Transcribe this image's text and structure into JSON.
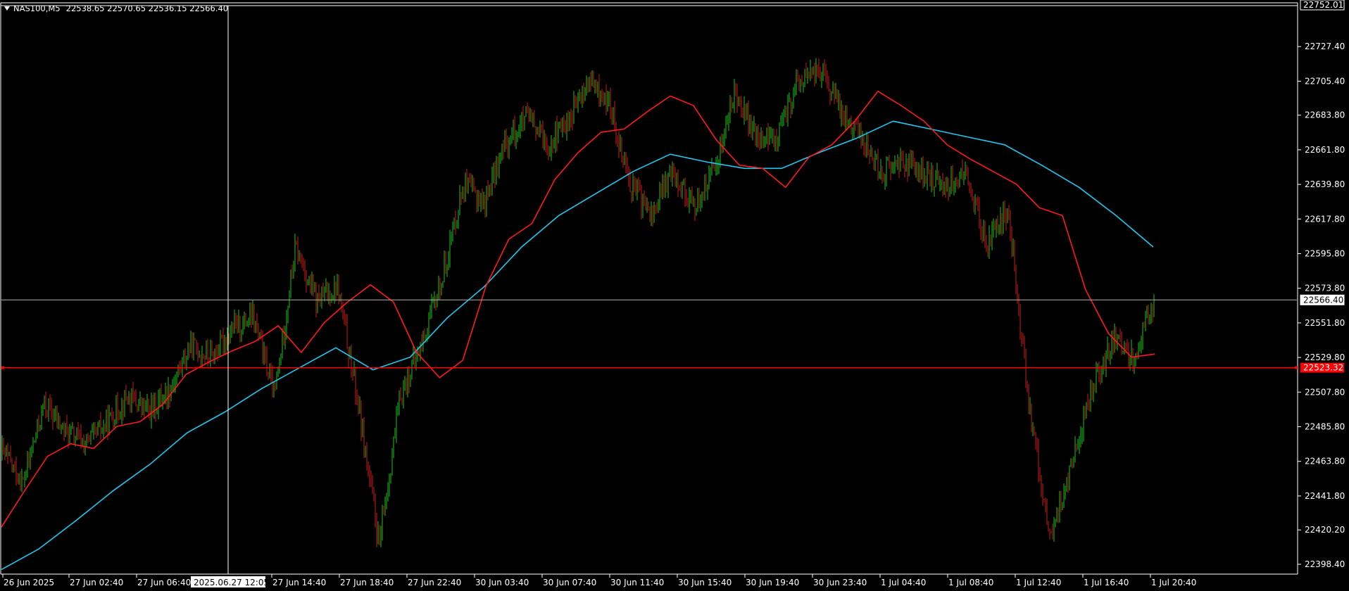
{
  "window": {
    "symbol": "NAS100,M5",
    "ohlc": "22538.65 22570.65 22536.15 22566.40"
  },
  "colors": {
    "background": "#000000",
    "bull_candle": "#22c01e",
    "bear_candle": "#c81e1e",
    "ma_fast": "#ff1a1a",
    "ma_slow": "#1ec8f0",
    "price_line": "#ff0000",
    "bid_line": "#b4b4b4",
    "grid": "#ffffff"
  },
  "price_axis": {
    "top_label": "22752.01",
    "ticks": [
      "22727.40",
      "22705.40",
      "22683.80",
      "22661.80",
      "22639.80",
      "22617.80",
      "22595.80",
      "22573.80",
      "22551.80",
      "22529.80",
      "22507.80",
      "22485.80",
      "22463.80",
      "22441.80",
      "22420.20",
      "22398.40"
    ],
    "current_price": "22566.40",
    "marked_price": "22523.32"
  },
  "time_axis": {
    "labels": [
      "26 Jun 2025",
      "27 Jun 02:40",
      "27 Jun 06:40",
      "27 Jun 14:40",
      "27 Jun 18:40",
      "27 Jun 22:40",
      "30 Jun 03:40",
      "30 Jun 07:40",
      "30 Jun 11:40",
      "30 Jun 15:40",
      "30 Jun 19:40",
      "30 Jun 23:40",
      "1 Jul 04:40",
      "1 Jul 08:40",
      "1 Jul 12:40",
      "1 Jul 16:40",
      "1 Jul 20:40"
    ],
    "crosshair_label": "2025.06.27 12:05"
  },
  "chart_data": {
    "type": "candlestick",
    "symbol": "NAS100",
    "timeframe": "M5",
    "ylim": [
      22390,
      22752.01
    ],
    "close_path": [
      {
        "t": "26 Jun 2025",
        "price": 22470
      },
      {
        "t": "26 Jun",
        "price": 22450
      },
      {
        "t": "26 Jun",
        "price": 22500
      },
      {
        "t": "26 Jun",
        "price": 22483
      },
      {
        "t": "27 Jun 02:40",
        "price": 22475
      },
      {
        "t": "27 Jun 02:40",
        "price": 22488
      },
      {
        "t": "27 Jun 02:40",
        "price": 22505
      },
      {
        "t": "27 Jun 06:40",
        "price": 22495
      },
      {
        "t": "27 Jun 06:40",
        "price": 22510
      },
      {
        "t": "27 Jun 06:40",
        "price": 22537
      },
      {
        "t": "27 Jun 12:05",
        "price": 22530
      },
      {
        "t": "27 Jun 14:40",
        "price": 22548
      },
      {
        "t": "27 Jun 14:40",
        "price": 22555
      },
      {
        "t": "27 Jun 14:40",
        "price": 22505
      },
      {
        "t": "27 Jun 14:40",
        "price": 22600
      },
      {
        "t": "27 Jun 18:40",
        "price": 22565
      },
      {
        "t": "27 Jun 18:40",
        "price": 22575
      },
      {
        "t": "27 Jun 18:40",
        "price": 22500
      },
      {
        "t": "27 Jun 18:40",
        "price": 22410
      },
      {
        "t": "27 Jun 22:40",
        "price": 22505
      },
      {
        "t": "27 Jun 22:40",
        "price": 22538
      },
      {
        "t": "27 Jun 22:40",
        "price": 22580
      },
      {
        "t": "27 Jun 22:40",
        "price": 22640
      },
      {
        "t": "30 Jun 03:40",
        "price": 22628
      },
      {
        "t": "30 Jun 03:40",
        "price": 22665
      },
      {
        "t": "30 Jun 07:40",
        "price": 22682
      },
      {
        "t": "30 Jun 07:40",
        "price": 22665
      },
      {
        "t": "30 Jun 07:40",
        "price": 22680
      },
      {
        "t": "30 Jun 11:40",
        "price": 22705
      },
      {
        "t": "30 Jun 11:40",
        "price": 22690
      },
      {
        "t": "30 Jun 15:40",
        "price": 22640
      },
      {
        "t": "30 Jun 15:40",
        "price": 22620
      },
      {
        "t": "30 Jun 15:40",
        "price": 22650
      },
      {
        "t": "30 Jun 19:40",
        "price": 22625
      },
      {
        "t": "30 Jun 19:40",
        "price": 22650
      },
      {
        "t": "30 Jun 19:40",
        "price": 22700
      },
      {
        "t": "30 Jun 19:40",
        "price": 22668
      },
      {
        "t": "30 Jun 23:40",
        "price": 22670
      },
      {
        "t": "30 Jun 23:40",
        "price": 22705
      },
      {
        "t": "1 Jul 04:40",
        "price": 22713
      },
      {
        "t": "1 Jul 04:40",
        "price": 22688
      },
      {
        "t": "1 Jul 04:40",
        "price": 22670
      },
      {
        "t": "1 Jul 08:40",
        "price": 22648
      },
      {
        "t": "1 Jul 08:40",
        "price": 22655
      },
      {
        "t": "1 Jul 08:40",
        "price": 22645
      },
      {
        "t": "1 Jul 12:40",
        "price": 22640
      },
      {
        "t": "1 Jul 12:40",
        "price": 22646
      },
      {
        "t": "1 Jul 12:40",
        "price": 22600
      },
      {
        "t": "1 Jul 12:40",
        "price": 22625
      },
      {
        "t": "1 Jul 16:40",
        "price": 22500
      },
      {
        "t": "1 Jul 16:40",
        "price": 22415
      },
      {
        "t": "1 Jul 16:40",
        "price": 22460
      },
      {
        "t": "1 Jul 16:40",
        "price": 22510
      },
      {
        "t": "1 Jul 20:40",
        "price": 22540
      },
      {
        "t": "1 Jul 20:40",
        "price": 22530
      },
      {
        "t": "1 Jul 20:40",
        "price": 22566.4
      }
    ],
    "ma_fast_path": [
      {
        "t": "26 Jun 2025",
        "price": 22422
      },
      {
        "t": "26 Jun",
        "price": 22445
      },
      {
        "t": "26 Jun",
        "price": 22467
      },
      {
        "t": "27 Jun 02:40",
        "price": 22475
      },
      {
        "t": "27 Jun 02:40",
        "price": 22472
      },
      {
        "t": "27 Jun 02:40",
        "price": 22486
      },
      {
        "t": "27 Jun 06:40",
        "price": 22489
      },
      {
        "t": "27 Jun 06:40",
        "price": 22500
      },
      {
        "t": "27 Jun 06:40",
        "price": 22519
      },
      {
        "t": "27 Jun 12:05",
        "price": 22527
      },
      {
        "t": "27 Jun 14:40",
        "price": 22534
      },
      {
        "t": "27 Jun 14:40",
        "price": 22540
      },
      {
        "t": "27 Jun 14:40",
        "price": 22550
      },
      {
        "t": "27 Jun 14:40",
        "price": 22533
      },
      {
        "t": "27 Jun 14:40",
        "price": 22552
      },
      {
        "t": "27 Jun 18:40",
        "price": 22565
      },
      {
        "t": "27 Jun 18:40",
        "price": 22576
      },
      {
        "t": "27 Jun 18:40",
        "price": 22565
      },
      {
        "t": "27 Jun 18:40",
        "price": 22533
      },
      {
        "t": "27 Jun 22:40",
        "price": 22517
      },
      {
        "t": "27 Jun 22:40",
        "price": 22528
      },
      {
        "t": "27 Jun 22:40",
        "price": 22575
      },
      {
        "t": "27 Jun 22:40",
        "price": 22605
      },
      {
        "t": "30 Jun 03:40",
        "price": 22615
      },
      {
        "t": "30 Jun 03:40",
        "price": 22643
      },
      {
        "t": "30 Jun 07:40",
        "price": 22660
      },
      {
        "t": "30 Jun 07:40",
        "price": 22673
      },
      {
        "t": "30 Jun 07:40",
        "price": 22675
      },
      {
        "t": "30 Jun 11:40",
        "price": 22686
      },
      {
        "t": "30 Jun 11:40",
        "price": 22696
      },
      {
        "t": "30 Jun 15:40",
        "price": 22690
      },
      {
        "t": "30 Jun 15:40",
        "price": 22668
      },
      {
        "t": "30 Jun 15:40",
        "price": 22652
      },
      {
        "t": "30 Jun 19:40",
        "price": 22650
      },
      {
        "t": "30 Jun 19:40",
        "price": 22638
      },
      {
        "t": "30 Jun 19:40",
        "price": 22657
      },
      {
        "t": "30 Jun 23:40",
        "price": 22665
      },
      {
        "t": "30 Jun 23:40",
        "price": 22680
      },
      {
        "t": "1 Jul 04:40",
        "price": 22699
      },
      {
        "t": "1 Jul 04:40",
        "price": 22690
      },
      {
        "t": "1 Jul 04:40",
        "price": 22680
      },
      {
        "t": "1 Jul 08:40",
        "price": 22665
      },
      {
        "t": "1 Jul 08:40",
        "price": 22656
      },
      {
        "t": "1 Jul 12:40",
        "price": 22648
      },
      {
        "t": "1 Jul 12:40",
        "price": 22640
      },
      {
        "t": "1 Jul 12:40",
        "price": 22625
      },
      {
        "t": "1 Jul 16:40",
        "price": 22620
      },
      {
        "t": "1 Jul 16:40",
        "price": 22573
      },
      {
        "t": "1 Jul 16:40",
        "price": 22545
      },
      {
        "t": "1 Jul 20:40",
        "price": 22530
      },
      {
        "t": "1 Jul 20:40",
        "price": 22532
      }
    ],
    "ma_slow_path": [
      {
        "t": "26 Jun 2025",
        "price": 22395
      },
      {
        "t": "26 Jun",
        "price": 22408
      },
      {
        "t": "27 Jun 02:40",
        "price": 22426
      },
      {
        "t": "27 Jun 06:40",
        "price": 22445
      },
      {
        "t": "27 Jun 06:40",
        "price": 22462
      },
      {
        "t": "27 Jun 12:05",
        "price": 22482
      },
      {
        "t": "27 Jun 14:40",
        "price": 22495
      },
      {
        "t": "27 Jun 14:40",
        "price": 22510
      },
      {
        "t": "27 Jun 18:40",
        "price": 22523
      },
      {
        "t": "27 Jun 18:40",
        "price": 22536
      },
      {
        "t": "27 Jun 22:40",
        "price": 22522
      },
      {
        "t": "27 Jun 22:40",
        "price": 22530
      },
      {
        "t": "30 Jun 03:40",
        "price": 22555
      },
      {
        "t": "30 Jun 03:40",
        "price": 22575
      },
      {
        "t": "30 Jun 07:40",
        "price": 22600
      },
      {
        "t": "30 Jun 07:40",
        "price": 22620
      },
      {
        "t": "30 Jun 11:40",
        "price": 22634
      },
      {
        "t": "30 Jun 11:40",
        "price": 22648
      },
      {
        "t": "30 Jun 15:40",
        "price": 22659
      },
      {
        "t": "30 Jun 15:40",
        "price": 22654
      },
      {
        "t": "30 Jun 19:40",
        "price": 22650
      },
      {
        "t": "30 Jun 19:40",
        "price": 22650
      },
      {
        "t": "30 Jun 23:40",
        "price": 22660
      },
      {
        "t": "30 Jun 23:40",
        "price": 22669
      },
      {
        "t": "1 Jul 04:40",
        "price": 22680
      },
      {
        "t": "1 Jul 04:40",
        "price": 22675
      },
      {
        "t": "1 Jul 08:40",
        "price": 22670
      },
      {
        "t": "1 Jul 12:40",
        "price": 22665
      },
      {
        "t": "1 Jul 12:40",
        "price": 22652
      },
      {
        "t": "1 Jul 16:40",
        "price": 22638
      },
      {
        "t": "1 Jul 16:40",
        "price": 22620
      },
      {
        "t": "1 Jul 20:40",
        "price": 22600
      }
    ]
  }
}
